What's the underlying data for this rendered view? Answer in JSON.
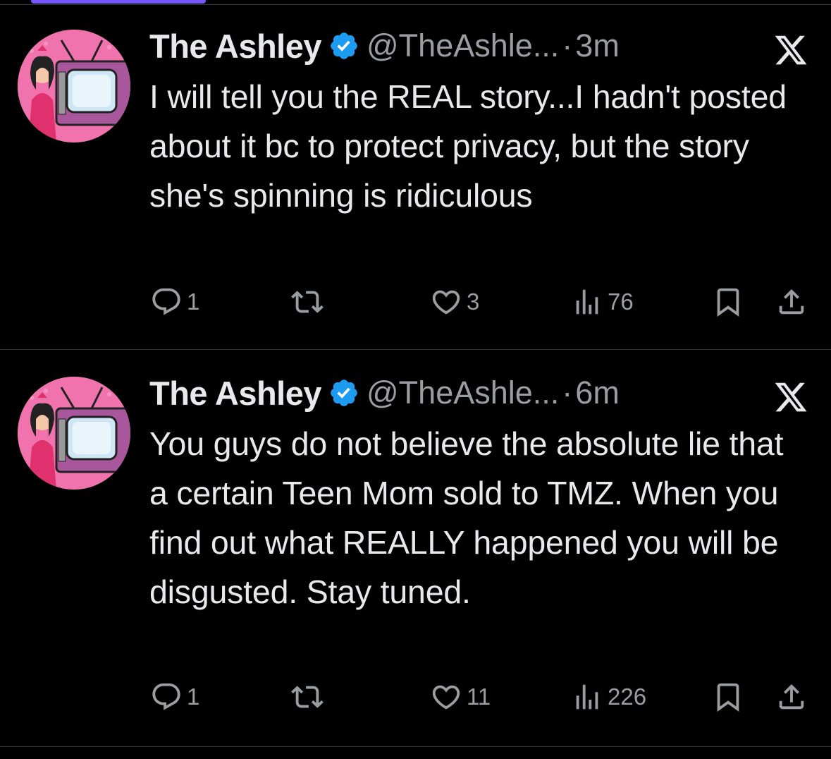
{
  "tweets": [
    {
      "display_name": "The Ashley",
      "handle": "@TheAshle...",
      "separator": "·",
      "time": "3m",
      "text": "I will tell you the REAL story...I hadn't posted about it bc to protect privacy, but the story she's spinning is ridiculous",
      "replies": "1",
      "reposts": "",
      "likes": "3",
      "views": "76"
    },
    {
      "display_name": "The Ashley",
      "handle": "@TheAshle...",
      "separator": "·",
      "time": "6m",
      "text": "You guys do not believe the absolute lie that a certain Teen Mom sold to TMZ. When you find out what REALLY happened you will be disgusted. Stay tuned.",
      "replies": "1",
      "reposts": "",
      "likes": "11",
      "views": "226"
    }
  ],
  "colors": {
    "background": "#000000",
    "text": "#e7e9ea",
    "secondary": "#9a9ea3",
    "verified": "#1d9bf0",
    "divider": "#2f3336",
    "accent": "#7856ff"
  },
  "icons": [
    "verified-badge-icon",
    "x-logo-icon",
    "reply-icon",
    "repost-icon",
    "like-icon",
    "views-icon",
    "bookmark-icon",
    "share-icon"
  ]
}
